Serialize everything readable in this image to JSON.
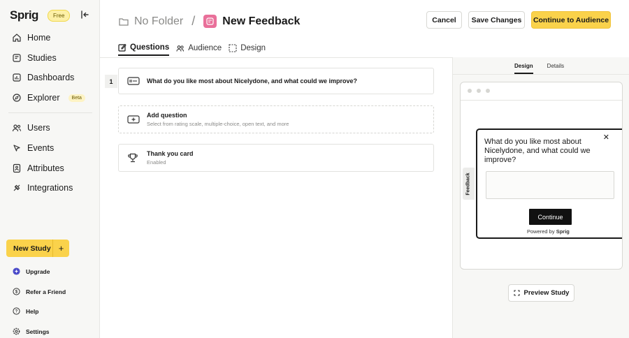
{
  "sidebar": {
    "logo": "Sprig",
    "plan_badge": "Free",
    "nav": [
      {
        "label": "Home",
        "icon": "home-icon"
      },
      {
        "label": "Studies",
        "icon": "studies-icon"
      },
      {
        "label": "Dashboards",
        "icon": "dashboard-icon"
      },
      {
        "label": "Explorer",
        "icon": "explorer-icon",
        "badge": "Beta"
      },
      {
        "label": "Users",
        "icon": "users-icon"
      },
      {
        "label": "Events",
        "icon": "events-icon"
      },
      {
        "label": "Attributes",
        "icon": "attributes-icon"
      },
      {
        "label": "Integrations",
        "icon": "integrations-icon"
      }
    ],
    "new_study_label": "New Study",
    "footer": [
      {
        "label": "Upgrade",
        "icon": "upgrade-icon"
      },
      {
        "label": "Refer a Friend",
        "icon": "refer-icon"
      },
      {
        "label": "Help",
        "icon": "help-icon"
      },
      {
        "label": "Settings",
        "icon": "settings-icon"
      }
    ]
  },
  "header": {
    "folder": "No Folder",
    "separator": "/",
    "study_title": "New Feedback",
    "cancel": "Cancel",
    "save": "Save Changes",
    "continue": "Continue to Audience"
  },
  "tabs": [
    {
      "label": "Questions",
      "active": true
    },
    {
      "label": "Audience",
      "active": false
    },
    {
      "label": "Design",
      "active": false
    }
  ],
  "questions": {
    "number": "1",
    "q1": "What do you like most about Nicelydone, and what could we improve?",
    "add_title": "Add question",
    "add_sub": "Select from rating scale, multiple-choice, open text, and more",
    "thanks_title": "Thank you card",
    "thanks_sub": "Enabled"
  },
  "preview": {
    "tabs": [
      {
        "label": "Design",
        "active": true
      },
      {
        "label": "Details",
        "active": false
      }
    ],
    "feedback_tab": "Feedback",
    "question": "What do you like most about Nicelydone, and what could we improve?",
    "continue": "Continue",
    "powered_by": "Powered by",
    "powered_brand": "Sprig",
    "preview_button": "Preview Study"
  },
  "colors": {
    "accent": "#fad24b",
    "study_icon": "#e9709a"
  }
}
